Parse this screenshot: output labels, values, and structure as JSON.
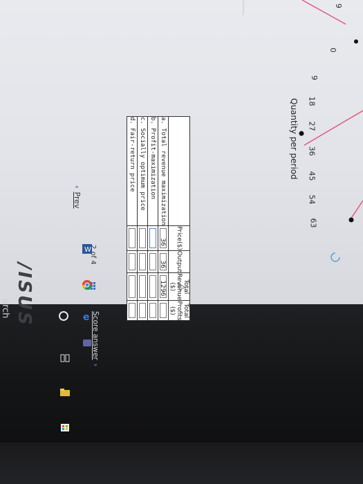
{
  "graph": {
    "x_ticks": [
      "0",
      "9",
      "18",
      "27",
      "36",
      "45",
      "54",
      "63"
    ],
    "y_top_tick": "9",
    "axis_label": "Quantity per period",
    "line_color": "#e05a7a",
    "point_color": "#111111"
  },
  "table": {
    "headers": {
      "price": "Price($)",
      "output": "Output",
      "revenue": "Total Revenue ($)",
      "profits": "Total Profits ($)"
    },
    "rows": [
      {
        "label": "a. Total revenue maximization",
        "price": "36",
        "output": "36",
        "revenue": "1296",
        "profits": ""
      },
      {
        "label": "b. Profit-maximization",
        "price": "",
        "output": "",
        "revenue": "",
        "profits": ""
      },
      {
        "label": "c. Socially optimum price",
        "price": "",
        "output": "",
        "revenue": "",
        "profits": ""
      },
      {
        "label": "d. Fair-return price",
        "price": "",
        "output": "",
        "revenue": "",
        "profits": ""
      }
    ]
  },
  "nav": {
    "prev_label": "Prev",
    "page_current": "2",
    "page_of": "of",
    "page_total": "4",
    "score_label": "Score answer",
    "accent": "#3b6ec2"
  },
  "taskbar": {
    "search_text": "arch",
    "brand": "/ISUS"
  }
}
